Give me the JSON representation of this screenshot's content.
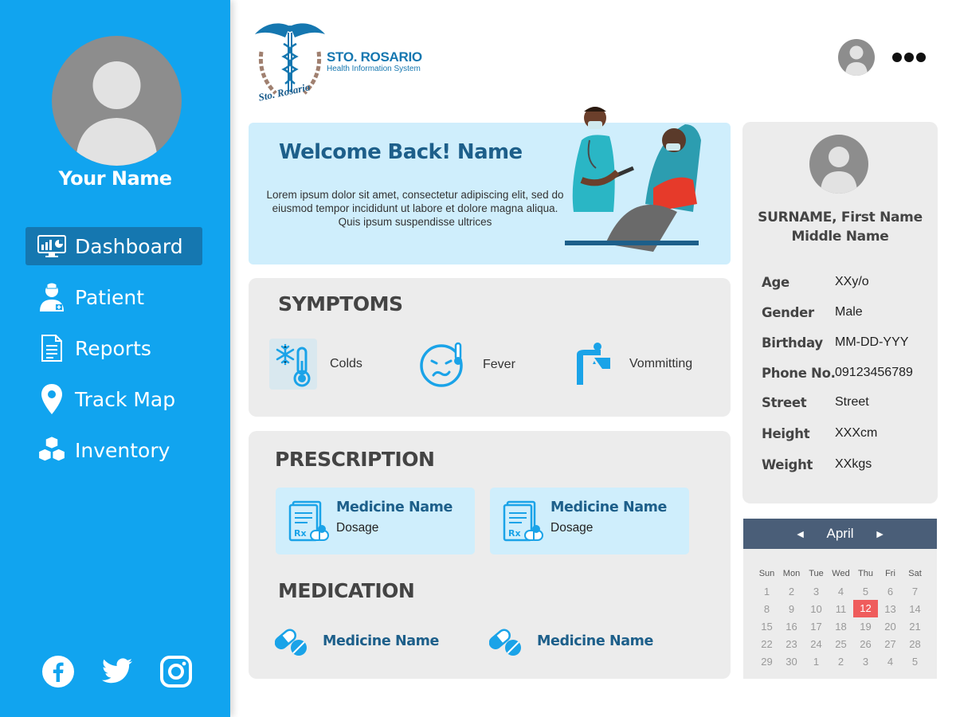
{
  "user": {
    "name": "Your Name"
  },
  "nav": [
    {
      "label": "Dashboard",
      "icon": "dashboard-icon",
      "active": true
    },
    {
      "label": "Patient",
      "icon": "patient-icon"
    },
    {
      "label": "Reports",
      "icon": "reports-icon"
    },
    {
      "label": "Track Map",
      "icon": "map-pin-icon"
    },
    {
      "label": "Inventory",
      "icon": "boxes-icon"
    }
  ],
  "social": [
    "facebook-icon",
    "twitter-icon",
    "instagram-icon"
  ],
  "brand": {
    "title": "STO. ROSARIO",
    "subtitle": "Health Information System",
    "motto": "Sto. Rosario",
    "primary_color": "#1577b0",
    "sidebar_color": "#11a4ef"
  },
  "welcome": {
    "title": "Welcome Back! Name",
    "text": "Lorem ipsum dolor sit amet, consectetur adipiscing elit, sed do eiusmod tempor incididunt ut labore et dolore magna aliqua. Quis ipsum suspendisse ultrices"
  },
  "symptoms": {
    "title": "SYMPTOMS",
    "items": [
      {
        "label": "Colds",
        "icon": "cold-thermometer-icon"
      },
      {
        "label": "Fever",
        "icon": "fever-face-icon"
      },
      {
        "label": "Vommitting",
        "icon": "vomiting-icon"
      }
    ]
  },
  "prescription": {
    "title": "PRESCRIPTION",
    "items": [
      {
        "name": "Medicine Name",
        "dosage": "Dosage",
        "icon": "prescription-icon"
      },
      {
        "name": "Medicine Name",
        "dosage": "Dosage",
        "icon": "prescription-icon"
      }
    ]
  },
  "medication": {
    "title": "MEDICATION",
    "items": [
      {
        "name": "Medicine Name",
        "icon": "pills-icon"
      },
      {
        "name": "Medicine Name",
        "icon": "pills-icon"
      }
    ]
  },
  "profile": {
    "name": "SURNAME, First Name Middle Name",
    "fields": [
      {
        "label": "Age",
        "value": "XXy/o"
      },
      {
        "label": "Gender",
        "value": "Male"
      },
      {
        "label": "Birthday",
        "value": "MM-DD-YYY"
      },
      {
        "label": "Phone No.",
        "value": "09123456789"
      },
      {
        "label": "Street",
        "value": "Street"
      },
      {
        "label": "Height",
        "value": "XXXcm"
      },
      {
        "label": "Weight",
        "value": "XXkgs"
      }
    ]
  },
  "calendar": {
    "month": "April",
    "prev": "◄",
    "next": "►",
    "weekdays": [
      "Sun",
      "Mon",
      "Tue",
      "Wed",
      "Thu",
      "Fri",
      "Sat"
    ],
    "weeks": [
      [
        "1",
        "2",
        "3",
        "4",
        "5",
        "6",
        "7"
      ],
      [
        "8",
        "9",
        "10",
        "11",
        "12",
        "13",
        "14"
      ],
      [
        "15",
        "16",
        "17",
        "18",
        "19",
        "20",
        "21"
      ],
      [
        "22",
        "23",
        "24",
        "25",
        "26",
        "27",
        "28"
      ],
      [
        "29",
        "30",
        "1",
        "2",
        "3",
        "4",
        "5"
      ]
    ],
    "today": "12",
    "today_color": "#ef5c5c"
  }
}
